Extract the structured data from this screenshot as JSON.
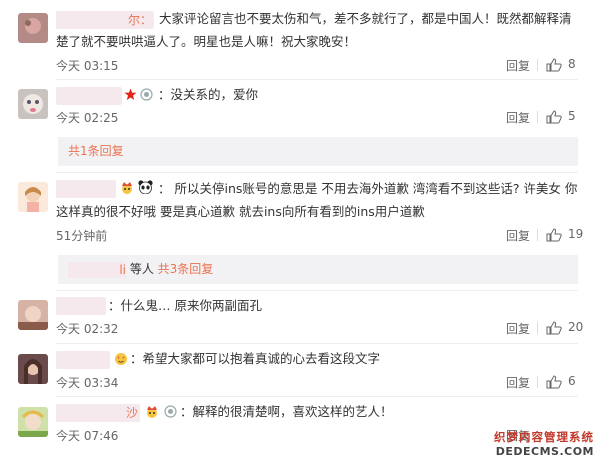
{
  "comments": [
    {
      "name": "尔：",
      "text": "大家评论留言也不要太伤和气，差不多就行了，都是中国人！既然都解释清楚了就不要哄哄逼人了。明星也是人嘛！祝大家晚安！",
      "time": "今天 03:15",
      "reply": "回复",
      "likes": "8"
    },
    {
      "name": "",
      "text": "：没关系的，爱你",
      "time": "今天 02:25",
      "reply": "回复",
      "likes": "5",
      "subreplies": "共1条回复"
    },
    {
      "name": "",
      "text": "： 所以关停ins账号的意思是 不用去海外道歉 湾湾看不到这些话? 许美女 你这样真的很不好哦 要是真心道歉 就去ins向所有看到的ins用户道歉",
      "time": "51分钟前",
      "reply": "回复",
      "likes": "19",
      "sub_user": "li",
      "sub_others": "等人",
      "subreplies": "共3条回复"
    },
    {
      "name": "",
      "text": "：什么鬼… 原来你两副面孔",
      "time": "今天 02:32",
      "reply": "回复",
      "likes": "20"
    },
    {
      "name": "",
      "text": "：希望大家都可以抱着真诚的心去看这段文字",
      "time": "今天 03:34",
      "reply": "回复",
      "likes": "6"
    },
    {
      "name": "沙",
      "text": "：解释的很清楚啊，喜欢这样的艺人！",
      "time": "今天 07:46",
      "reply": "回复"
    }
  ],
  "watermark": {
    "line1": "织梦内容管理系统",
    "line2": "DEDECMS.COM"
  },
  "colors": {
    "link": "#eb7350",
    "text": "#333333",
    "meta": "#666666"
  },
  "icons": [
    "avatar",
    "red-star-icon",
    "vip-badge-icon",
    "thumb-up-icon",
    "crown-icon",
    "panda-icon",
    "heart-eyes-icon"
  ]
}
